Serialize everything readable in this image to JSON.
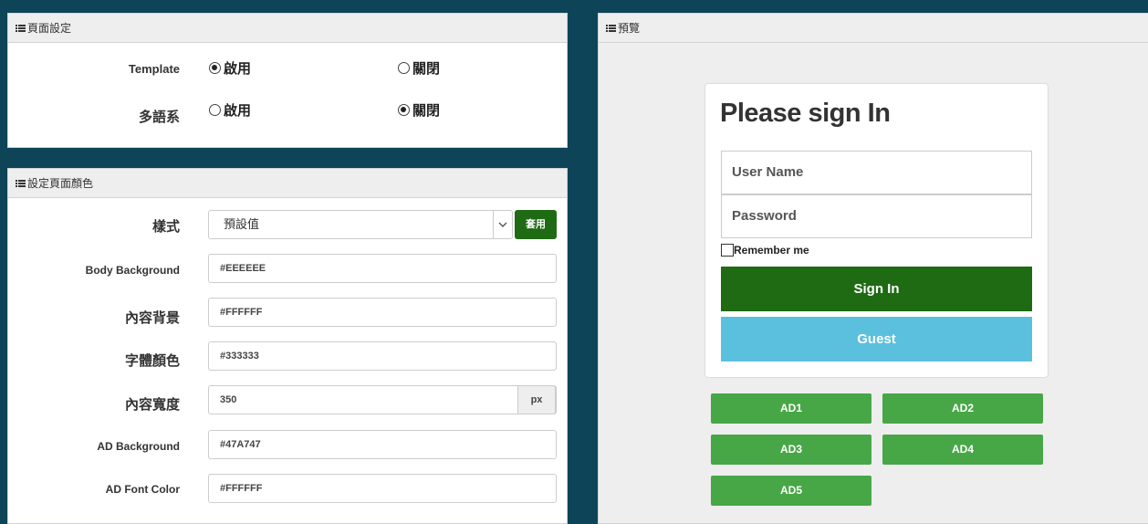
{
  "page_settings": {
    "title": "頁面設定",
    "template": {
      "label": "Template",
      "enable": "啟用",
      "disable": "關閉"
    },
    "multilang": {
      "label": "多語系",
      "enable": "啟用",
      "disable": "關閉"
    }
  },
  "color_settings": {
    "title": "設定頁面顏色",
    "style": {
      "label": "樣式",
      "value": "預設值",
      "apply": "套用"
    },
    "body_bg": {
      "label": "Body Background",
      "value": "#EEEEEE"
    },
    "content_bg": {
      "label": "內容背景",
      "value": "#FFFFFF"
    },
    "font_color": {
      "label": "字體顏色",
      "value": "#333333"
    },
    "content_width": {
      "label": "內容寬度",
      "value": "350",
      "unit": "px"
    },
    "ad_bg": {
      "label": "AD Background",
      "value": "#47A747"
    },
    "ad_font": {
      "label": "AD Font Color",
      "value": "#FFFFFF"
    }
  },
  "preview": {
    "title": "預覽",
    "heading": "Please sign In",
    "username_placeholder": "User Name",
    "password_placeholder": "Password",
    "remember": "Remember me",
    "signin": "Sign In",
    "guest": "Guest",
    "ads": [
      "AD1",
      "AD2",
      "AD3",
      "AD4",
      "AD5"
    ]
  },
  "colors": {
    "signin_button": "#1e6b14",
    "guest_button": "#5bc0de",
    "ad_button": "#47a747",
    "apply_button": "#1e6b14",
    "frame": "#0d4458"
  }
}
